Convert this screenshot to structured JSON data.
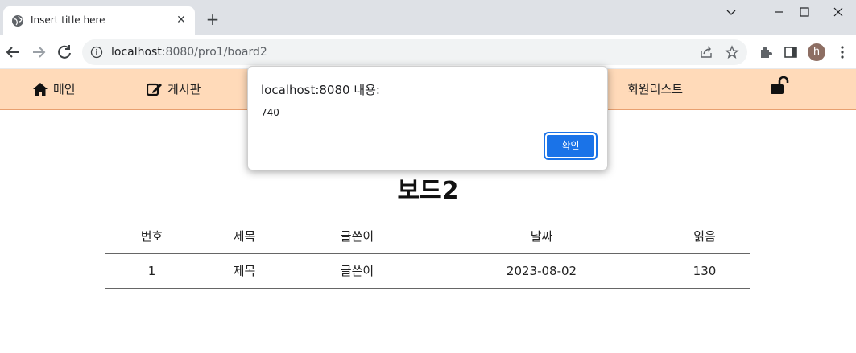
{
  "browser": {
    "tab_title": "Insert title here",
    "url_host": "localhost",
    "url_rest": ":8080/pro1/board2",
    "profile_initial": "h"
  },
  "nav": {
    "home": "메인",
    "board": "게시판",
    "member_list": "회원리스트"
  },
  "page": {
    "title": "보드2"
  },
  "table": {
    "headers": [
      "번호",
      "제목",
      "글쓴이",
      "날짜",
      "읽음"
    ],
    "rows": [
      [
        "1",
        "제목",
        "글쓴이",
        "2023-08-02",
        "130"
      ]
    ]
  },
  "dialog": {
    "title": "localhost:8080 내용:",
    "message": "740",
    "ok_label": "확인"
  },
  "colors": {
    "nav_bg": "#ffdab9",
    "ok_button": "#1a73e8"
  }
}
